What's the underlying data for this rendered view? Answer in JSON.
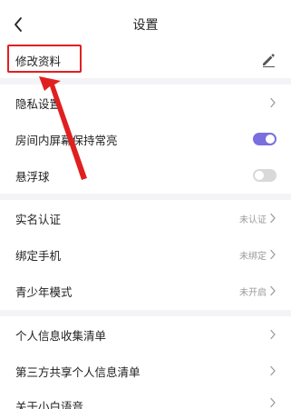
{
  "header": {
    "title": "设置",
    "back_icon": "chevron-left-icon"
  },
  "edit_profile": {
    "label": "修改资料",
    "icon": "pencil-icon"
  },
  "settings": {
    "privacy": {
      "label": "隐私设置"
    },
    "screen_on": {
      "label": "房间内屏幕保持常亮",
      "enabled": true
    },
    "float_ball": {
      "label": "悬浮球",
      "enabled": false
    },
    "real_name": {
      "label": "实名认证",
      "value": "未认证"
    },
    "bind_phone": {
      "label": "绑定手机",
      "value": "未绑定"
    },
    "teen_mode": {
      "label": "青少年模式",
      "value": "未开启"
    },
    "personal_info": {
      "label": "个人信息收集清单"
    },
    "third_party": {
      "label": "第三方共享个人信息清单"
    },
    "about": {
      "label": "关于小白语音"
    }
  },
  "colors": {
    "accent": "#7b6fe0",
    "annotation_red": "#e02020",
    "divider": "#f4f4f7"
  }
}
